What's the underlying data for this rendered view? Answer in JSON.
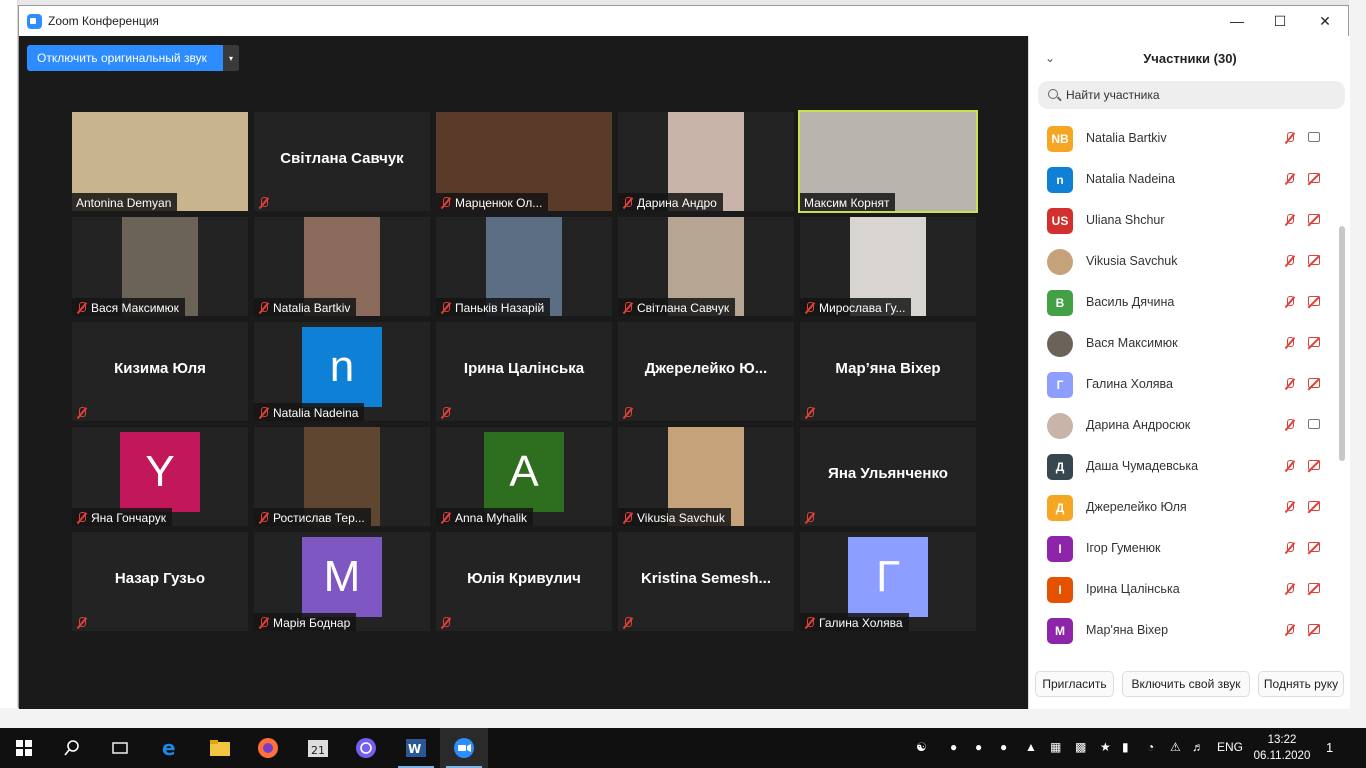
{
  "window": {
    "title": "Zoom Конференция",
    "minimize": "—",
    "maximize": "☐",
    "close": "✕"
  },
  "audio_button": {
    "label": "Отключить оригинальный звук",
    "dropdown": "▾"
  },
  "tiles": [
    {
      "name": "Antonina Demyan",
      "type": "photo",
      "muted": false,
      "bg": "#c9b58d"
    },
    {
      "name": "Світлана Савчук",
      "type": "name",
      "muted": true
    },
    {
      "name": "Марценюк Ол...",
      "type": "photo",
      "muted": true,
      "bg": "#5a3a28"
    },
    {
      "name": "Дарина Андро",
      "type": "photo",
      "muted": true,
      "bg": "#c8b4a8"
    },
    {
      "name": "Максим Корнят",
      "type": "photo",
      "muted": false,
      "active": true,
      "bg": "#b9b5ae"
    },
    {
      "name": "Вася Максимюк",
      "type": "photo",
      "muted": true,
      "bg": "#6b6258"
    },
    {
      "name": "Natalia Bartkiv",
      "type": "photo",
      "muted": true,
      "bg": "#8a6a5a"
    },
    {
      "name": "Паньків Назарій",
      "type": "photo",
      "muted": true,
      "bg": "#5b6e84"
    },
    {
      "name": "Світлана Савчук",
      "type": "photo",
      "muted": true,
      "bg": "#b5a592"
    },
    {
      "name": "Мирослава Гу...",
      "type": "photo",
      "muted": true,
      "bg": "#d8d4cf"
    },
    {
      "name": "Кизима Юля",
      "type": "name",
      "muted": true
    },
    {
      "name": "Natalia Nadeina",
      "type": "avatar",
      "letter": "n",
      "color": "#0e80d5",
      "muted": true
    },
    {
      "name": "Ірина Цалінська",
      "type": "name",
      "muted": true
    },
    {
      "name": "Джерелейко  Ю...",
      "type": "name",
      "muted": true
    },
    {
      "name": "Мар’яна Віхер",
      "type": "name",
      "muted": true
    },
    {
      "name": "Яна Гончарук",
      "type": "avatar",
      "letter": "Y",
      "color": "#c2185b",
      "muted": true
    },
    {
      "name": "Ростислав Тер...",
      "type": "photo",
      "muted": true,
      "bg": "#5e4630"
    },
    {
      "name": "Anna Myhalik",
      "type": "avatar",
      "letter": "A",
      "color": "#2e6f1f",
      "muted": true
    },
    {
      "name": "Vikusia Savchuk",
      "type": "photo",
      "muted": true,
      "bg": "#c6a27a"
    },
    {
      "name": "Яна Ульянченко",
      "type": "name",
      "muted": true
    },
    {
      "name": "Назар Гузьо",
      "type": "name",
      "muted": true
    },
    {
      "name": "Марія Боднар",
      "type": "avatar",
      "letter": "M",
      "color": "#7e57c2",
      "muted": true
    },
    {
      "name": "Юлія Кривулич",
      "type": "name",
      "muted": true
    },
    {
      "name": "Kristina  Semesh...",
      "type": "name",
      "muted": true
    },
    {
      "name": "Галина Холява",
      "type": "avatar",
      "letter": "Г",
      "color": "#8c9eff",
      "muted": true
    }
  ],
  "panel": {
    "title": "Участники (30)",
    "search_placeholder": "Найти участника",
    "participants": [
      {
        "initials": "NB",
        "name": "Natalia Bartkiv",
        "color": "#f5a623",
        "cam": true
      },
      {
        "initials": "n",
        "name": "Natalia Nadeina",
        "color": "#0e80d5",
        "cam": false
      },
      {
        "initials": "US",
        "name": "Uliana Shchur",
        "color": "#d32f2f",
        "cam": false
      },
      {
        "initials": "",
        "name": "Vikusia Savchuk",
        "color": "#c6a27a",
        "cam": false
      },
      {
        "initials": "В",
        "name": "Василь Дячина",
        "color": "#43a047",
        "cam": false
      },
      {
        "initials": "",
        "name": "Вася Максимюк",
        "color": "#6b6258",
        "cam": false
      },
      {
        "initials": "Г",
        "name": "Галина Холява",
        "color": "#8c9eff",
        "cam": false
      },
      {
        "initials": "",
        "name": "Дарина Андросюк",
        "color": "#c8b4a8",
        "cam": true
      },
      {
        "initials": "Д",
        "name": "Даша Чумадевська",
        "color": "#37474f",
        "cam": false
      },
      {
        "initials": "Д",
        "name": "Джерелейко Юля",
        "color": "#f5a623",
        "cam": false
      },
      {
        "initials": "І",
        "name": "Ігор Гуменюк",
        "color": "#8e24aa",
        "cam": false
      },
      {
        "initials": "І",
        "name": "Ірина Цалінська",
        "color": "#e65100",
        "cam": false
      },
      {
        "initials": "M",
        "name": "Мар'яна Віхер",
        "color": "#8e24aa",
        "cam": false
      }
    ],
    "buttons": {
      "invite": "Пригласить",
      "unmute": "Включить свой звук",
      "raise_hand": "Поднять руку"
    }
  },
  "taskbar": {
    "lang": "ENG",
    "time": "13:22",
    "date": "06.11.2020",
    "notifications": "1"
  }
}
